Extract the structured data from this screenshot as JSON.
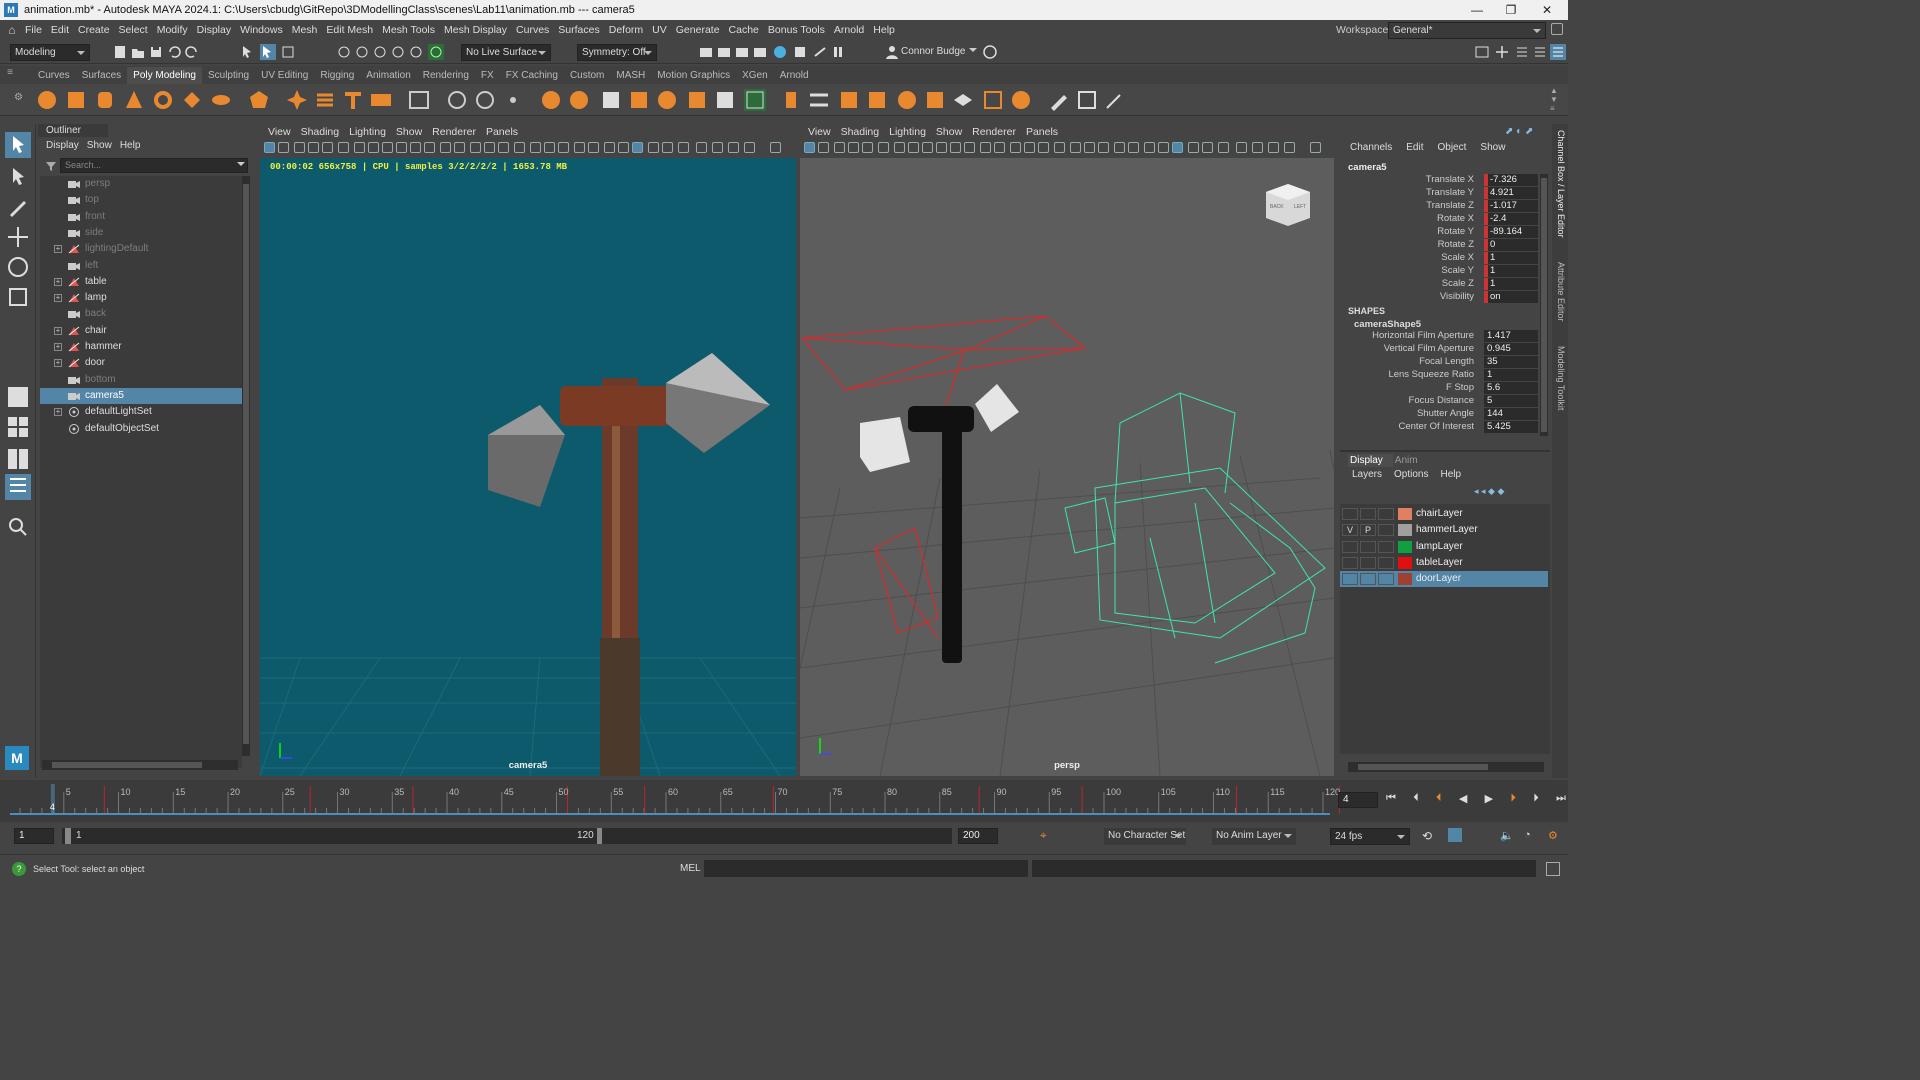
{
  "titlebar": {
    "file": "animation.mb*",
    "title_text": "animation.mb* - Autodesk MAYA 2024.1: C:\\Users\\cbudg\\GitRepo\\3DModellingClass\\scenes\\Lab11\\animation.mb   ---   camera5",
    "logo": "M"
  },
  "menu": [
    "File",
    "Edit",
    "Create",
    "Select",
    "Modify",
    "Display",
    "Windows",
    "Mesh",
    "Edit Mesh",
    "Mesh Tools",
    "Mesh Display",
    "Curves",
    "Surfaces",
    "Deform",
    "UV",
    "Generate",
    "Cache",
    "Bonus Tools",
    "Arnold",
    "Help"
  ],
  "workspace": {
    "label": "Workspace:",
    "value": "General*"
  },
  "statusline": {
    "menuset": "Modeling",
    "live_surface": "No Live Surface",
    "symmetry": "Symmetry: Off",
    "user": "Connor Budge"
  },
  "shelf_tabs": [
    "Curves",
    "Surfaces",
    "Poly Modeling",
    "Sculpting",
    "UV Editing",
    "Rigging",
    "Animation",
    "Rendering",
    "FX",
    "FX Caching",
    "Custom",
    "MASH",
    "Motion Graphics",
    "XGen",
    "Arnold"
  ],
  "shelf_active": "Poly Modeling",
  "outliner": {
    "tab": "Outliner",
    "menu": [
      "Display",
      "Show",
      "Help"
    ],
    "search_placeholder": "Search...",
    "items": [
      {
        "label": "persp",
        "icon": "camera-icon",
        "dim": true,
        "expand": false
      },
      {
        "label": "top",
        "icon": "camera-icon",
        "dim": true,
        "expand": false
      },
      {
        "label": "front",
        "icon": "camera-icon",
        "dim": true,
        "expand": false
      },
      {
        "label": "side",
        "icon": "camera-icon",
        "dim": true,
        "expand": false
      },
      {
        "label": "lightingDefault",
        "icon": "transform-icon",
        "dim": true,
        "expand": true
      },
      {
        "label": "left",
        "icon": "camera-icon",
        "dim": true,
        "expand": false
      },
      {
        "label": "table",
        "icon": "transform-icon",
        "dim": false,
        "expand": true
      },
      {
        "label": "lamp",
        "icon": "transform-icon",
        "dim": false,
        "expand": true
      },
      {
        "label": "back",
        "icon": "camera-icon",
        "dim": true,
        "expand": false
      },
      {
        "label": "chair",
        "icon": "transform-icon",
        "dim": false,
        "expand": true
      },
      {
        "label": "hammer",
        "icon": "transform-icon",
        "dim": false,
        "expand": true
      },
      {
        "label": "door",
        "icon": "transform-icon",
        "dim": false,
        "expand": true
      },
      {
        "label": "bottom",
        "icon": "camera-icon",
        "dim": true,
        "expand": false
      },
      {
        "label": "camera5",
        "icon": "camera-icon",
        "dim": false,
        "expand": false,
        "selected": true
      },
      {
        "label": "defaultLightSet",
        "icon": "set-icon",
        "dim": false,
        "expand": true
      },
      {
        "label": "defaultObjectSet",
        "icon": "set-icon",
        "dim": false,
        "expand": false
      }
    ]
  },
  "viewport_left": {
    "menu": [
      "View",
      "Shading",
      "Lighting",
      "Show",
      "Renderer",
      "Panels"
    ],
    "hud": "00:00:02 656x758 | CPU | samples 3/2/2/2/2 | 1653.78 MB",
    "camera": "camera5"
  },
  "viewport_right": {
    "menu": [
      "View",
      "Shading",
      "Lighting",
      "Show",
      "Renderer",
      "Panels"
    ],
    "camera": "persp",
    "viewcube": {
      "a": "BACK",
      "b": "LEFT"
    }
  },
  "channelbox": {
    "menu": [
      "Channels",
      "Edit",
      "Object",
      "Show"
    ],
    "object": "camera5",
    "channels": [
      {
        "k": "Translate X",
        "v": "-7.326",
        "keyed": true
      },
      {
        "k": "Translate Y",
        "v": "4.921",
        "keyed": true
      },
      {
        "k": "Translate Z",
        "v": "-1.017",
        "keyed": true
      },
      {
        "k": "Rotate X",
        "v": "-2.4",
        "keyed": true
      },
      {
        "k": "Rotate Y",
        "v": "-89.164",
        "keyed": true
      },
      {
        "k": "Rotate Z",
        "v": "0",
        "keyed": true
      },
      {
        "k": "Scale X",
        "v": "1",
        "keyed": true
      },
      {
        "k": "Scale Y",
        "v": "1",
        "keyed": true
      },
      {
        "k": "Scale Z",
        "v": "1",
        "keyed": true
      },
      {
        "k": "Visibility",
        "v": "on",
        "keyed": true
      }
    ],
    "shapes_header": "SHAPES",
    "shape_name": "cameraShape5",
    "shape_channels": [
      {
        "k": "Horizontal Film Aperture",
        "v": "1.417"
      },
      {
        "k": "Vertical Film Aperture",
        "v": "0.945"
      },
      {
        "k": "Focal Length",
        "v": "35"
      },
      {
        "k": "Lens Squeeze Ratio",
        "v": "1"
      },
      {
        "k": "F Stop",
        "v": "5.6"
      },
      {
        "k": "Focus Distance",
        "v": "5"
      },
      {
        "k": "Shutter Angle",
        "v": "144"
      },
      {
        "k": "Center Of Interest",
        "v": "5.425"
      }
    ]
  },
  "layers": {
    "tabs": [
      "Display",
      "Anim"
    ],
    "menu": [
      "Layers",
      "Options",
      "Help"
    ],
    "items": [
      {
        "name": "chairLayer",
        "v": "",
        "p": "",
        "color": "#e08060",
        "selected": false
      },
      {
        "name": "hammerLayer",
        "v": "V",
        "p": "P",
        "color": "#a0a0a0",
        "selected": false
      },
      {
        "name": "lampLayer",
        "v": "",
        "p": "",
        "color": "#10a040",
        "selected": false
      },
      {
        "name": "tableLayer",
        "v": "",
        "p": "",
        "color": "#e01010",
        "selected": false
      },
      {
        "name": "doorLayer",
        "v": "",
        "p": "",
        "color": "#a04030",
        "selected": true
      }
    ]
  },
  "right_strip": [
    "Channel Box / Layer Editor",
    "Attribute Editor",
    "Modeling Toolkit"
  ],
  "timeline": {
    "ticks": [
      "5",
      "10",
      "15",
      "20",
      "25",
      "30",
      "35",
      "40",
      "45",
      "50",
      "55",
      "60",
      "65",
      "70",
      "75",
      "80",
      "85",
      "90",
      "95",
      "100",
      "105",
      "110",
      "115",
      "120"
    ],
    "current_frame": "4",
    "current_frame_field": "4"
  },
  "range": {
    "start": "1",
    "inner_start": "1",
    "inner_end": "120",
    "end": "200",
    "character_set": "No Character Set",
    "anim_layer": "No Anim Layer",
    "fps": "24 fps"
  },
  "cmd": {
    "help": "Select Tool: select an object",
    "lang": "MEL"
  }
}
